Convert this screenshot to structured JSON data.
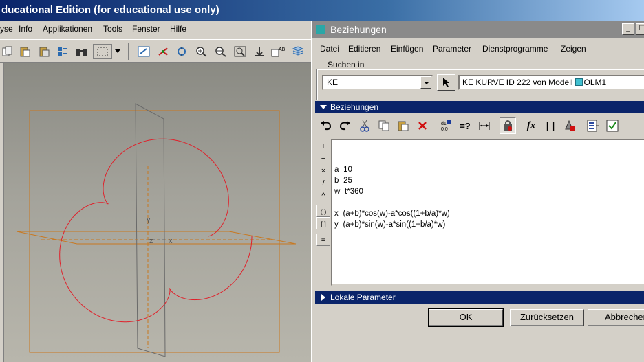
{
  "main_window": {
    "title": "ducational Edition (for educational use only)",
    "menu": [
      "yse",
      "Info",
      "Applikationen",
      "Tools",
      "Fenster",
      "Hilfe"
    ],
    "toolbar_icons": [
      "cut-icon",
      "copy-icon",
      "paste-icon",
      "paste-special-icon",
      "regenerate-icon",
      "find-icon",
      "select-box-icon",
      "dropdown-arrow-icon",
      "repaint-icon",
      "spin-center-icon",
      "orient-mode-icon",
      "zoom-in-icon",
      "zoom-out-icon",
      "refit-icon",
      "view-icon",
      "named-views-icon",
      "layers-icon"
    ],
    "graphics": {
      "axis_labels": {
        "y": "y",
        "z": "z",
        "x": "x"
      },
      "curve_color": "#e0202a",
      "plane_color": "#c87820",
      "datum_color": "#707070"
    }
  },
  "dialog": {
    "title": "Beziehungen",
    "title_buttons": {
      "minimize": "_",
      "maximize": "☐"
    },
    "menu": [
      "Datei",
      "Editieren",
      "Einfügen",
      "Parameter",
      "Dienstprogramme",
      "Zeigen"
    ],
    "search": {
      "legend": "Suchen in",
      "scope_value": "KE",
      "model_text": "KE KURVE ID 222 von Modell",
      "model_name": "OLM1"
    },
    "relations_section": "Beziehungen",
    "relations_toolbar": [
      "undo-icon",
      "redo-icon",
      "cut-icon",
      "copy-icon",
      "paste-icon",
      "delete-icon",
      "evaluate-icon",
      "verify-icon",
      "measure-icon",
      "lock-icon",
      "function-icon",
      "brackets-icon",
      "locate-icon",
      "sort-icon",
      "verify-relations-icon"
    ],
    "toolbar_labels": {
      "evaluate": "=?",
      "function": "fx",
      "brackets": "[ ]"
    },
    "operators": [
      "+",
      "−",
      "×",
      "/",
      "^",
      "( )",
      "[ ]",
      "="
    ],
    "relations": [
      "",
      "a=10",
      "b=25",
      "w=t*360",
      "",
      "x=(a+b)*cos(w)-a*cos((1+b/a)*w)",
      "y=(a+b)*sin(w)-a*sin((1+b/a)*w)"
    ],
    "local_params_section": "Lokale Parameter",
    "buttons": {
      "ok": "OK",
      "reset": "Zurücksetzen",
      "cancel": "Abbrechen"
    }
  }
}
